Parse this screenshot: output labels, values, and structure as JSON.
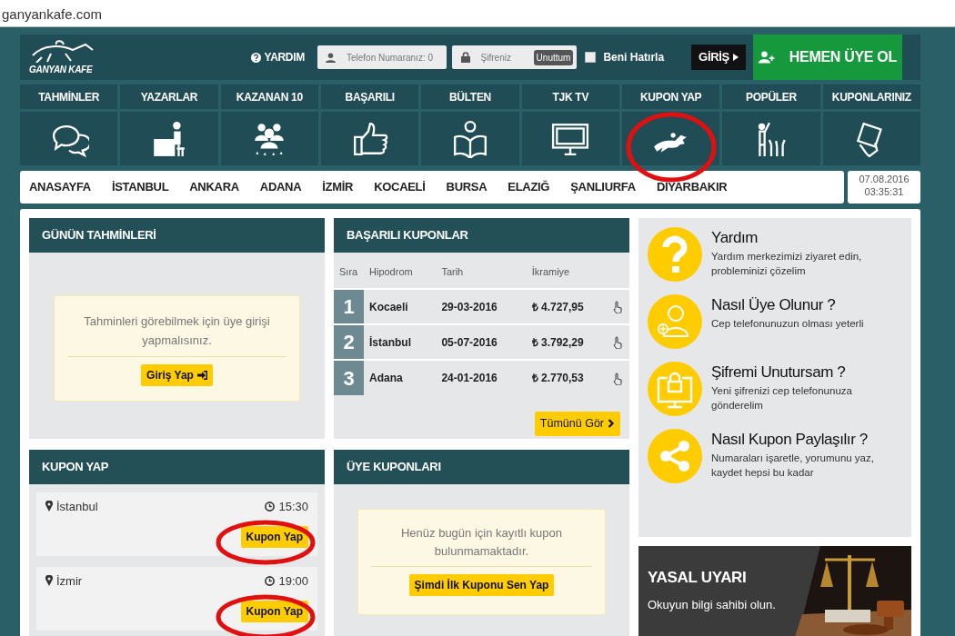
{
  "address_bar": {
    "url": "ganyankafe.com"
  },
  "header": {
    "logo_text": "GANYAN KAFE",
    "help": "YARDIM",
    "phone_placeholder": "Telefon Numaranız: 0",
    "password_placeholder": "Şifreniz",
    "forgot": "Unuttum",
    "remember": {
      "label": "Beni Hatırla",
      "checked": false
    },
    "login": "GİRİŞ",
    "signup": "HEMEN ÜYE OL"
  },
  "nav": [
    {
      "label": "TAHMİNLER",
      "kind": "speech",
      "circled": false
    },
    {
      "label": "YAZARLAR",
      "kind": "desk",
      "circled": false
    },
    {
      "label": "KAZANAN 10",
      "kind": "group",
      "circled": false
    },
    {
      "label": "BAŞARILI",
      "kind": "thumb",
      "circled": false
    },
    {
      "label": "BÜLTEN",
      "kind": "reader",
      "circled": false
    },
    {
      "label": "TJK TV",
      "kind": "monitor",
      "circled": false
    },
    {
      "label": "KUPON YAP",
      "kind": "horse",
      "circled": true
    },
    {
      "label": "POPÜLER",
      "kind": "crowd",
      "circled": false
    },
    {
      "label": "KUPONLARINIZ",
      "kind": "card",
      "circled": false
    }
  ],
  "cities": [
    "ANASAYFA",
    "İSTANBUL",
    "ANKARA",
    "ADANA",
    "İZMİR",
    "KOCAELİ",
    "BURSA",
    "ELAZIĞ",
    "ŞANLIURFA",
    "DİYARBAKIR"
  ],
  "datetime": {
    "date": "07.08.2016",
    "time": "03:35:31"
  },
  "predictions": {
    "title": "GÜNÜN TAHMİNLERİ",
    "message": "Tahminleri görebilmek için üye girişi yapmalısınız.",
    "button": "Giriş Yap"
  },
  "successful": {
    "title": "BAŞARILI KUPONLAR",
    "columns": [
      "Sıra",
      "Hipodrom",
      "Tarih",
      "İkramiye"
    ],
    "rows": [
      {
        "rank": "1",
        "track": "Kocaeli",
        "date": "29-03-2016",
        "prize": "₺ 4.727,95"
      },
      {
        "rank": "2",
        "track": "İstanbul",
        "date": "05-07-2016",
        "prize": "₺ 3.792,29"
      },
      {
        "rank": "3",
        "track": "Adana",
        "date": "24-01-2016",
        "prize": "₺ 2.770,53"
      }
    ],
    "button": "Tümünü Gör"
  },
  "help_items": [
    {
      "kind": "question",
      "title": "Yardım",
      "text": "Yardım merkezimizi ziyaret edin, probleminizi çözelim"
    },
    {
      "kind": "user",
      "title": "Nasıl Üye Olunur ?",
      "text": "Cep telefonunuzun olması yeterli"
    },
    {
      "kind": "lock",
      "title": "Şifremi Unutursam ?",
      "text": "Yeni şifrenizi cep telefonunuza gönderelim"
    },
    {
      "kind": "share",
      "title": "Nasıl Kupon Paylaşılır ?",
      "text": "Numaraları işaretle, yorumunu yaz, kaydet hepsi bu kadar"
    }
  ],
  "coupon": {
    "title": "KUPON YAP",
    "races": [
      {
        "city": "İstanbul",
        "time": "15:30",
        "button": "Kupon Yap",
        "circled": true
      },
      {
        "city": "İzmir",
        "time": "19:00",
        "button": "Kupon Yap",
        "circled": true
      }
    ]
  },
  "member_coupons": {
    "title": "ÜYE KUPONLARI",
    "message": "Henüz bugün için kayıtlı kupon bulunmamaktadır.",
    "button": "Şimdi İlk Kuponu Sen Yap"
  },
  "legal": {
    "title": "YASAL UYARI",
    "text": "Okuyun bilgi sahibi olun."
  }
}
